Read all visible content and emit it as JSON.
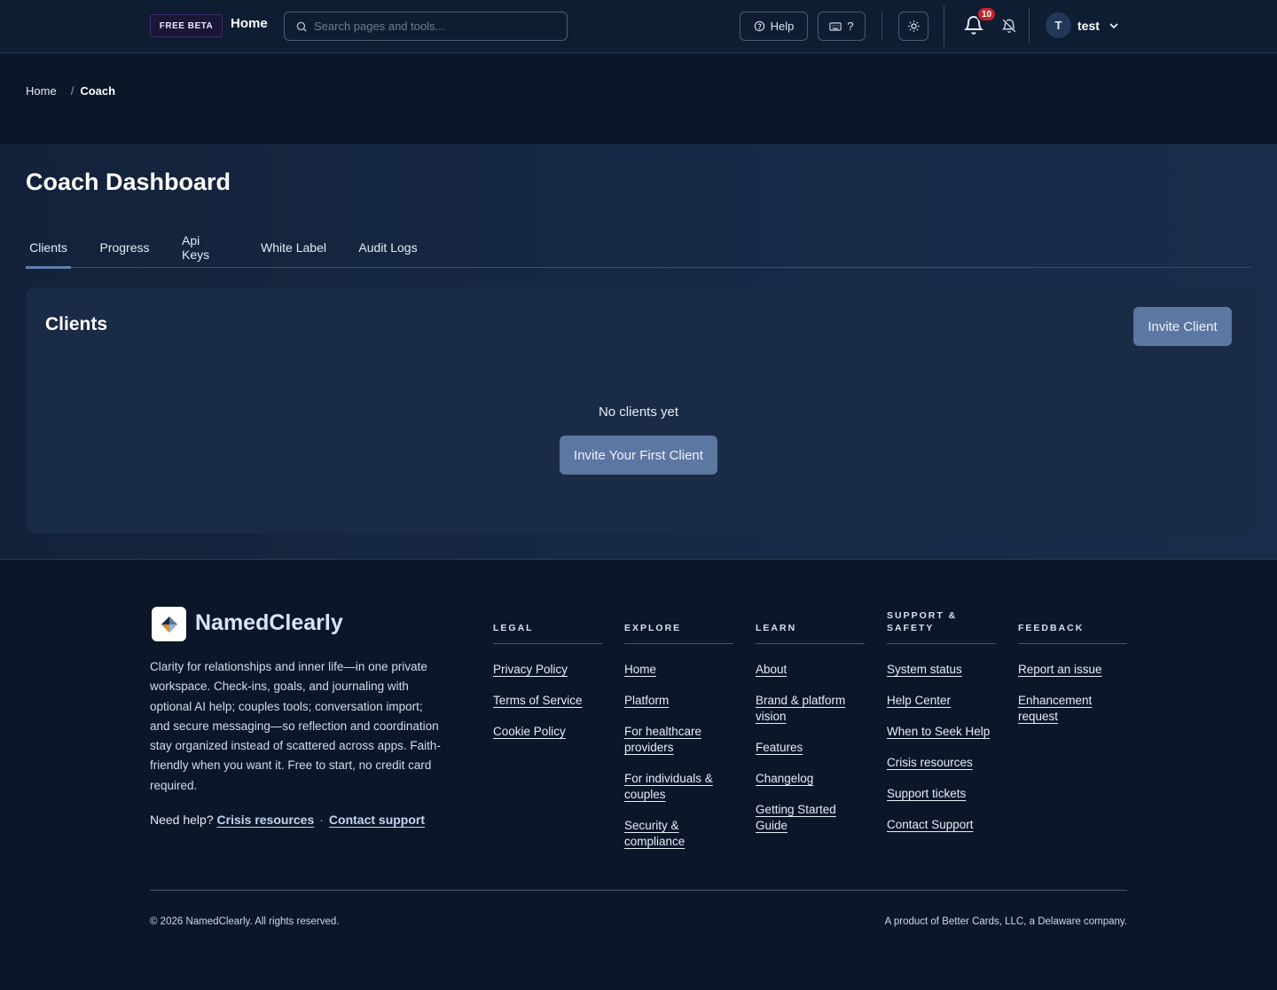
{
  "header": {
    "beta_badge": "FREE BETA",
    "home_label": "Home",
    "search_placeholder": "Search pages and tools...",
    "help_label": "Help",
    "shortcuts_label": "?",
    "notification_count": "10",
    "user_initial": "T",
    "username": "test"
  },
  "breadcrumb": {
    "home": "Home",
    "separator": "/",
    "current": "Coach"
  },
  "page": {
    "title": "Coach Dashboard",
    "tabs": [
      {
        "label": "Clients",
        "active": true
      },
      {
        "label": "Progress",
        "active": false
      },
      {
        "label": "Api Keys",
        "active": false
      },
      {
        "label": "White Label",
        "active": false
      },
      {
        "label": "Audit Logs",
        "active": false
      }
    ]
  },
  "clients_card": {
    "title": "Clients",
    "invite_button": "Invite Client",
    "empty_text": "No clients yet",
    "invite_first_button": "Invite Your First Client"
  },
  "footer": {
    "brand": "NamedClearly",
    "tagline": "Clarity for relationships and inner life—in one private workspace. Check-ins, goals, and journaling with optional AI help; couples tools; conversation import; and secure messaging—so reflection and coordination stay organized instead of scattered across apps. Faith-friendly when you want it. Free to start, no credit card required.",
    "need_help": "Need help?",
    "crisis_link": "Crisis resources",
    "dot": "·",
    "contact_link": "Contact support",
    "columns": [
      {
        "heading": "LEGAL",
        "links": [
          "Privacy Policy",
          "Terms of Service",
          "Cookie Policy"
        ]
      },
      {
        "heading": "EXPLORE",
        "links": [
          "Home",
          "Platform",
          "For healthcare providers",
          "For individuals & couples",
          "Security & compliance"
        ]
      },
      {
        "heading": "LEARN",
        "links": [
          "About",
          "Brand & platform vision",
          "Features",
          "Changelog",
          "Getting Started Guide"
        ]
      },
      {
        "heading": "SUPPORT & SAFETY",
        "links": [
          "System status",
          "Help Center",
          "When to Seek Help",
          "Crisis resources",
          "Support tickets",
          "Contact Support"
        ]
      },
      {
        "heading": "FEEDBACK",
        "links": [
          "Report an issue",
          "Enhancement request"
        ]
      }
    ],
    "copyright": "© 2026 NamedClearly. All rights reserved.",
    "product_of": "A product of Better Cards, LLC, a Delaware company."
  },
  "colors": {
    "background": "#0b1628",
    "card": "#1a2b46",
    "primary_button": "#5b77a2",
    "notification_badge": "#c0262f"
  },
  "icons": [
    "search-icon",
    "help-circle-icon",
    "keyboard-icon",
    "sun-icon",
    "bell-icon",
    "bell-off-icon",
    "chevron-down-icon",
    "logo-icon"
  ]
}
